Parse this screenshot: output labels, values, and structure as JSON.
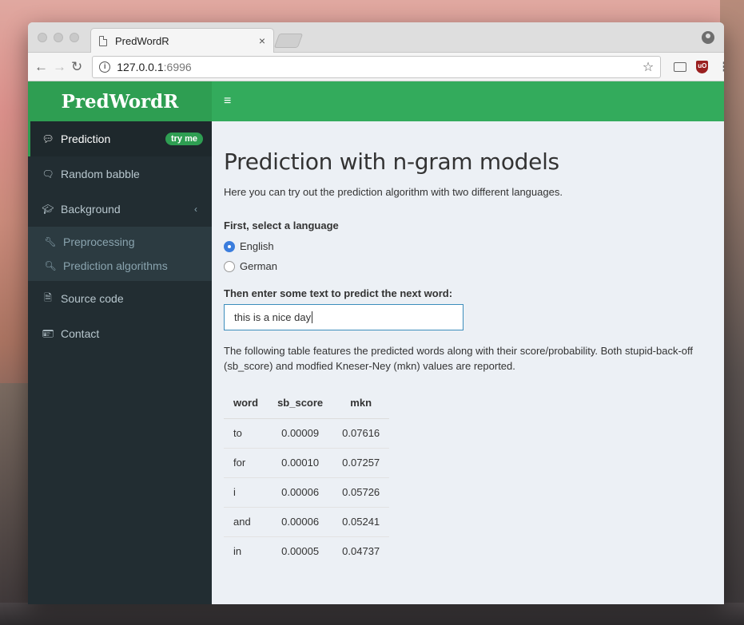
{
  "browser": {
    "tab_title": "PredWordR",
    "tab_close": "×",
    "url_host": "127.0.0.1",
    "url_port": ":6996"
  },
  "app": {
    "logo": "PredWordR",
    "menu_icon": "≡"
  },
  "sidebar": {
    "items": [
      {
        "label": "Prediction",
        "icon": "comment-icon",
        "badge": "try me"
      },
      {
        "label": "Random babble",
        "icon": "comments-icon"
      },
      {
        "label": "Background",
        "icon": "graduation-cap-icon"
      },
      {
        "label": "Source code",
        "icon": "file-code-icon"
      },
      {
        "label": "Contact",
        "icon": "address-card-icon"
      }
    ],
    "submenu": [
      {
        "label": "Preprocessing",
        "icon": "wrench-icon"
      },
      {
        "label": "Prediction algorithms",
        "icon": "search-icon"
      }
    ]
  },
  "main": {
    "title": "Prediction with n-gram models",
    "intro": "Here you can try out the prediction algorithm with two different languages.",
    "language_label": "First, select a language",
    "languages": [
      "English",
      "German"
    ],
    "selected_language": "English",
    "text_label": "Then enter some text to predict the next word:",
    "text_value": "this is a nice day",
    "table_description": "The following table features the predicted words along with their score/probability. Both stupid-back-off (sb_score) and modfied Kneser-Ney (mkn) values are reported.",
    "table": {
      "headers": [
        "word",
        "sb_score",
        "mkn"
      ],
      "rows": [
        [
          "to",
          "0.00009",
          "0.07616"
        ],
        [
          "for",
          "0.00010",
          "0.07257"
        ],
        [
          "i",
          "0.00006",
          "0.05726"
        ],
        [
          "and",
          "0.00006",
          "0.05241"
        ],
        [
          "in",
          "0.00005",
          "0.04737"
        ]
      ]
    }
  }
}
